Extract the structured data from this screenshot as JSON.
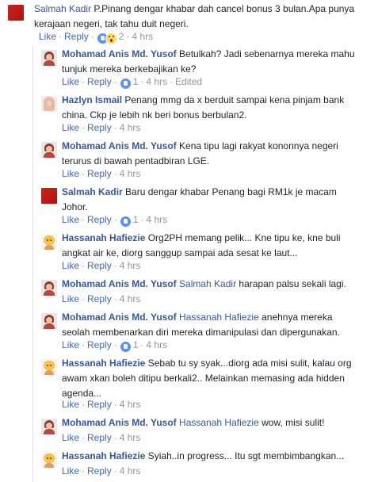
{
  "labels": {
    "like": "Like",
    "reply": "Reply",
    "edited": "Edited",
    "sep": "·"
  },
  "colors": {
    "name_link": "#365899",
    "action_link": "#4267b2",
    "meta": "#90949c",
    "like_blue": "#5890ff",
    "thread_line": "#dddfe2"
  },
  "comments": [
    {
      "author": "Salmah Kadir",
      "lines": [
        "P.Pinang dengar khabar dah cancel bonus 3 bulan.Apa punya",
        "kerajaan negeri, tak tahu duit negeri."
      ],
      "reactions": [
        "like-icon",
        "wow-icon"
      ],
      "reaction_count": "2",
      "time": "4 hrs"
    },
    {
      "author": "Mohamad Anis Md. Yusof",
      "lines": [
        " Betulkah? Jadi sebenarnya mereka mahu",
        "tunjuk mereka berkebajikan ke?"
      ],
      "reactions": [
        "like-icon"
      ],
      "reaction_count": "1",
      "time": "4 hrs"
    },
    {
      "author": "Hazlyn Ismail",
      "lines": [
        " Penang mmg da x berduit sampai kena pinjam bank",
        "china. Ckp je lebih nk beri bonus berbulan2."
      ],
      "time": "4 hrs"
    },
    {
      "author": "Mohamad Anis Md. Yusof",
      "lines": [
        " Kena tipu lagi rakyat kononnya negeri",
        "terurus di bawah pentadbiran LGE."
      ],
      "time": "4 hrs"
    },
    {
      "author": "Salmah Kadir",
      "lines": [
        " Baru dengar khabar Penang bagi RM1k je macam",
        "Johor."
      ],
      "reactions": [
        "like-icon"
      ],
      "reaction_count": "1",
      "time": "4 hrs"
    },
    {
      "author": "Hassanah Hafiezie",
      "lines": [
        " Org2PH memang pelik... Kne tipu ke, kne buli",
        "angkat air ke, diorg sanggup sampai ada sesat ke laut..."
      ],
      "time": "4 hrs"
    },
    {
      "author": "Mohamad Anis Md. Yusof",
      "tag": "Salmah Kadir",
      "lines": [
        " harapan palsu sekali lagi."
      ],
      "time": "4 hrs"
    },
    {
      "author": "Mohamad Anis Md. Yusof",
      "tag": "Hassanah Hafiezie",
      "lines": [
        " anehnya mereka",
        "seolah membenarkan diri mereka dimanipulasi dan dipergunakan."
      ],
      "reactions": [
        "like-icon"
      ],
      "reaction_count": "1",
      "time": "4 hrs"
    },
    {
      "author": "Hassanah Hafiezie",
      "lines": [
        " Sebab tu sy syak...diorg ada misi sulit, kalau org",
        "awam xkan boleh ditipu berkali2.. Melainkan memasing ada hidden",
        "agenda..."
      ],
      "time": "4 hrs"
    },
    {
      "author": "Mohamad Anis Md. Yusof",
      "tag": "Hassanah Hafiezie",
      "lines": [
        " wow, misi sulit!"
      ],
      "time": "4 hrs"
    },
    {
      "author": "Hassanah Hafiezie",
      "lines": [
        " Syiah..in progress... Itu sgt membimbangkan..."
      ],
      "time": "4 hrs"
    }
  ]
}
